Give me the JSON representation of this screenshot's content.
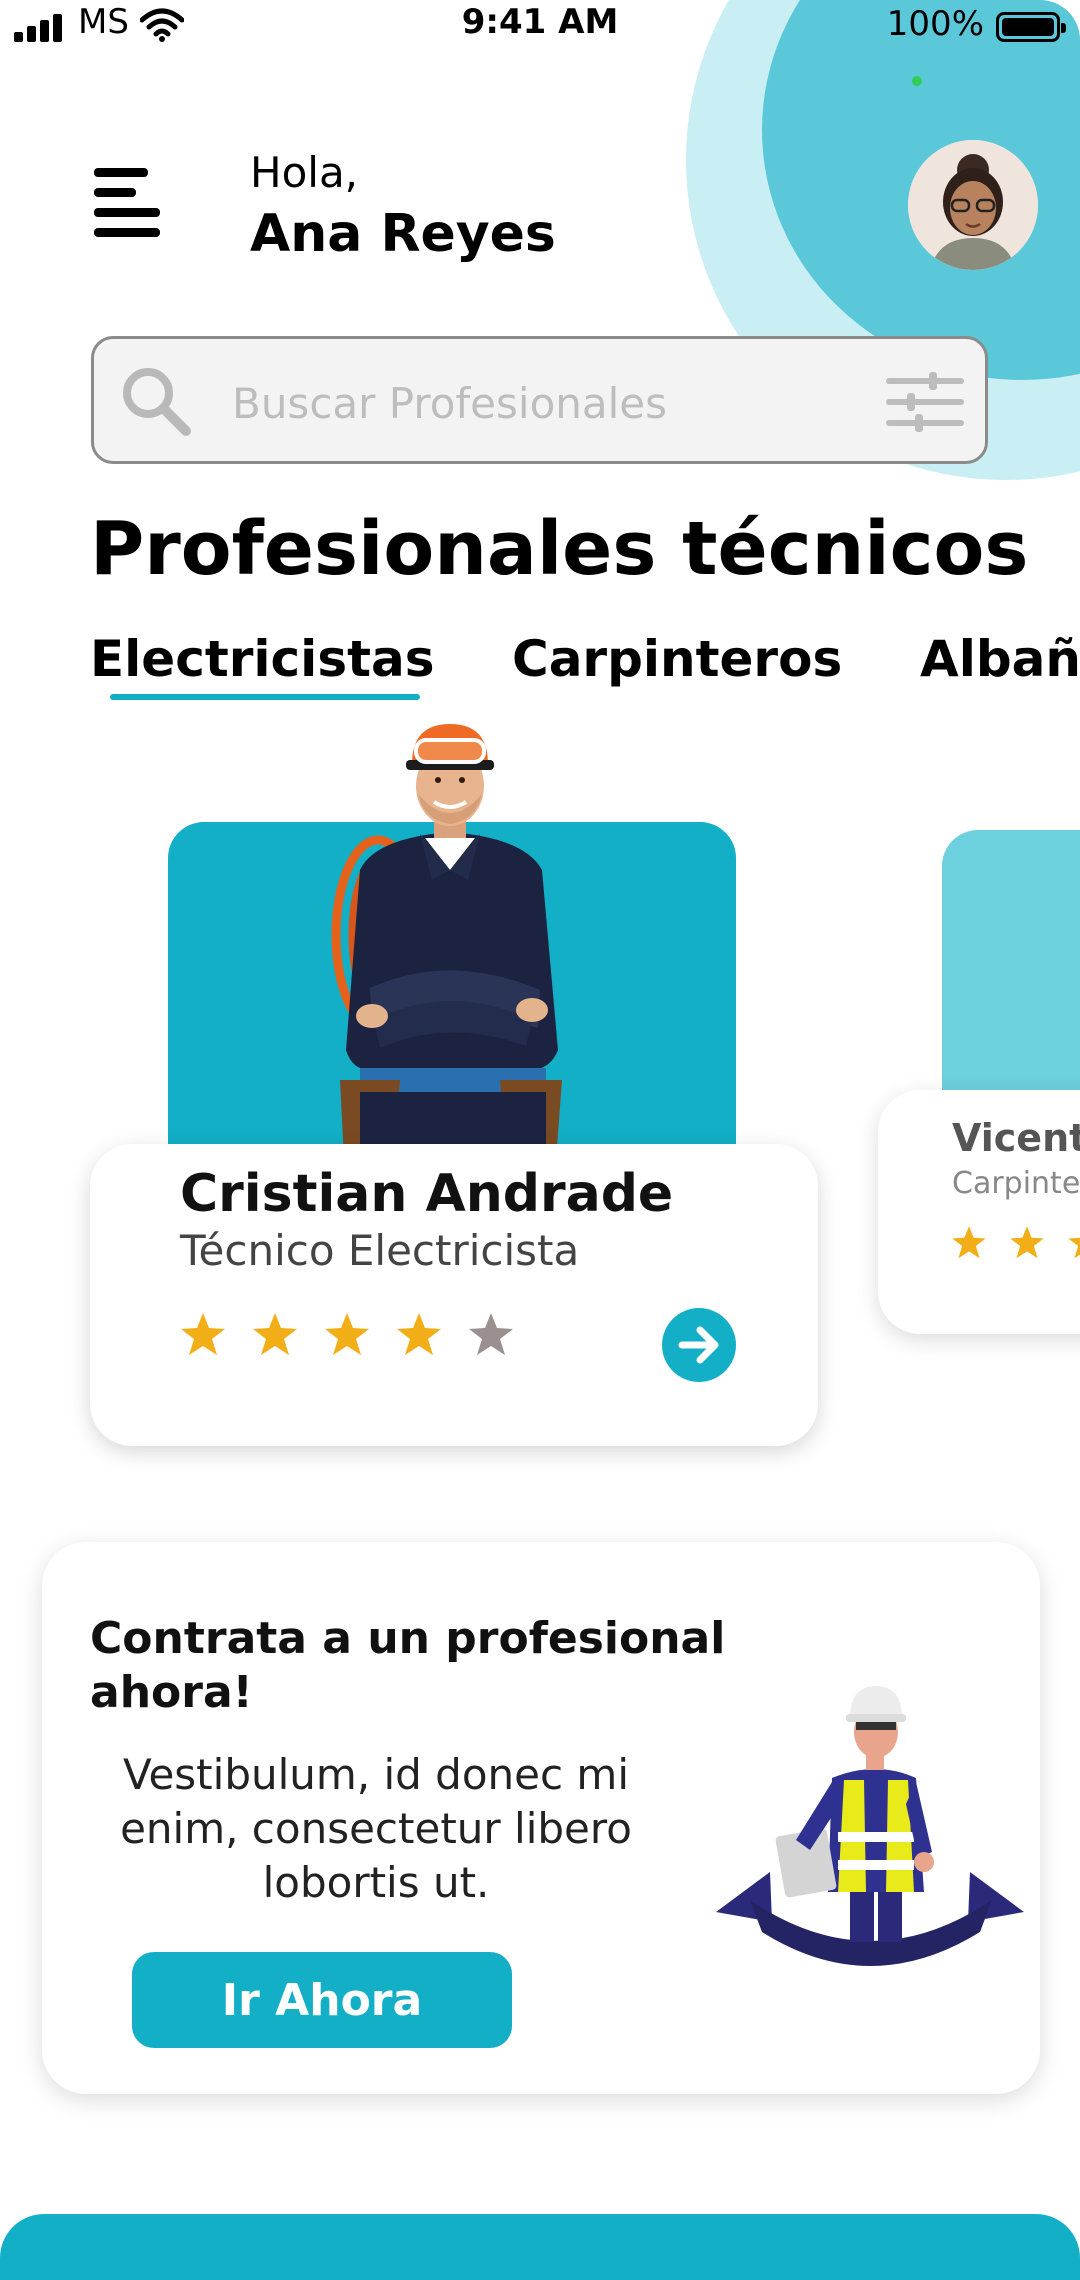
{
  "status_bar": {
    "carrier": "MS",
    "time": "9:41 AM",
    "battery": "100%"
  },
  "header": {
    "greeting": "Hola,",
    "user_name": "Ana Reyes"
  },
  "search": {
    "placeholder": "Buscar Profesionales"
  },
  "section": {
    "title": "Profesionales técnicos"
  },
  "tabs": [
    {
      "label": "Electricistas",
      "active": true
    },
    {
      "label": "Carpinteros",
      "active": false
    },
    {
      "label": "Albañ",
      "active": false
    }
  ],
  "professionals": [
    {
      "name": "Cristian Andrade",
      "role": "Técnico Electricista",
      "rating": 4,
      "max_rating": 5
    },
    {
      "name": "Vicente",
      "role": "Carpinte",
      "rating": 3,
      "max_rating": 5
    }
  ],
  "promo": {
    "title": "Contrata a un profesional ahora!",
    "text": "Vestibulum, id donec mi enim, consectetur libero lobortis ut.",
    "button_label": "Ir Ahora"
  },
  "colors": {
    "accent": "#12afc6",
    "circle_dark": "#5ac8d8",
    "circle_light": "#c9eef4",
    "star_filled": "#f2ae17",
    "star_empty": "#9a9090"
  },
  "icons": [
    "menu-icon",
    "search-icon",
    "filter-icon",
    "arrow-right-icon",
    "star-icon"
  ]
}
